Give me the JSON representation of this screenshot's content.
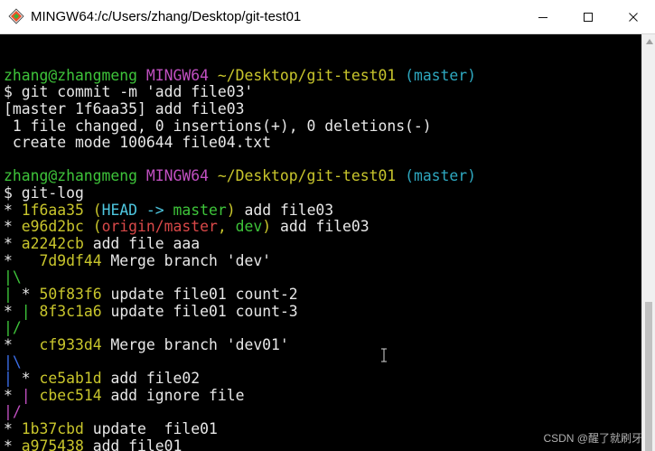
{
  "window": {
    "title": "MINGW64:/c/Users/zhang/Desktop/git-test01",
    "icon": "git-bash-icon",
    "controls": [
      "minimize-icon",
      "maximize-icon",
      "close-icon"
    ]
  },
  "colors": {
    "background": "#000000",
    "default_text": "#e8e8e8",
    "green": "#3ec43a",
    "magenta": "#c04fc0",
    "yellow": "#c9c62c",
    "cyan": "#2ea8c0",
    "bright_cyan": "#4ec7e0",
    "red": "#d84848",
    "graph_blue": "#3b6ee8"
  },
  "terminal": {
    "lines": [
      [],
      [
        {
          "text": "zhang@zhangmeng ",
          "color": "#3ec43a"
        },
        {
          "text": "MINGW64 ",
          "color": "#c04fc0"
        },
        {
          "text": "~/Desktop/git-test01 ",
          "color": "#c9c62c"
        },
        {
          "text": "(master)",
          "color": "#2ea8c0"
        }
      ],
      [
        {
          "text": "$ git commit -m 'add file03'",
          "color": "#e8e8e8"
        }
      ],
      [
        {
          "text": "[master 1f6aa35] add file03",
          "color": "#e8e8e8"
        }
      ],
      [
        {
          "text": " 1 file changed, 0 insertions(+), 0 deletions(-)",
          "color": "#e8e8e8"
        }
      ],
      [
        {
          "text": " create mode 100644 file04.txt",
          "color": "#e8e8e8"
        }
      ],
      [],
      [
        {
          "text": "zhang@zhangmeng ",
          "color": "#3ec43a"
        },
        {
          "text": "MINGW64 ",
          "color": "#c04fc0"
        },
        {
          "text": "~/Desktop/git-test01 ",
          "color": "#c9c62c"
        },
        {
          "text": "(master)",
          "color": "#2ea8c0"
        }
      ],
      [
        {
          "text": "$ git-log",
          "color": "#e8e8e8"
        }
      ],
      [
        {
          "text": "* ",
          "color": "#e8e8e8"
        },
        {
          "text": "1f6aa35",
          "color": "#c9c62c"
        },
        {
          "text": " (",
          "color": "#c9c62c"
        },
        {
          "text": "HEAD -> ",
          "color": "#4ec7e0"
        },
        {
          "text": "master",
          "color": "#3ec43a"
        },
        {
          "text": ")",
          "color": "#c9c62c"
        },
        {
          "text": " add file03",
          "color": "#e8e8e8"
        }
      ],
      [
        {
          "text": "* ",
          "color": "#e8e8e8"
        },
        {
          "text": "e96d2bc",
          "color": "#c9c62c"
        },
        {
          "text": " (",
          "color": "#c9c62c"
        },
        {
          "text": "origin/master",
          "color": "#d84848"
        },
        {
          "text": ", ",
          "color": "#c9c62c"
        },
        {
          "text": "dev",
          "color": "#3ec43a"
        },
        {
          "text": ")",
          "color": "#c9c62c"
        },
        {
          "text": " add file03",
          "color": "#e8e8e8"
        }
      ],
      [
        {
          "text": "* ",
          "color": "#e8e8e8"
        },
        {
          "text": "a2242cb",
          "color": "#c9c62c"
        },
        {
          "text": " add file aaa",
          "color": "#e8e8e8"
        }
      ],
      [
        {
          "text": "*   ",
          "color": "#e8e8e8"
        },
        {
          "text": "7d9df44",
          "color": "#c9c62c"
        },
        {
          "text": " Merge branch 'dev'",
          "color": "#e8e8e8"
        }
      ],
      [
        {
          "text": "|\\",
          "color": "#3ec43a"
        }
      ],
      [
        {
          "text": "| ",
          "color": "#3ec43a"
        },
        {
          "text": "* ",
          "color": "#e8e8e8"
        },
        {
          "text": "50f83f6",
          "color": "#c9c62c"
        },
        {
          "text": " update file01 count-2",
          "color": "#e8e8e8"
        }
      ],
      [
        {
          "text": "* ",
          "color": "#e8e8e8"
        },
        {
          "text": "| ",
          "color": "#3ec43a"
        },
        {
          "text": "8f3c1a6",
          "color": "#c9c62c"
        },
        {
          "text": " update file01 count-3",
          "color": "#e8e8e8"
        }
      ],
      [
        {
          "text": "|/",
          "color": "#3ec43a"
        }
      ],
      [
        {
          "text": "*   ",
          "color": "#e8e8e8"
        },
        {
          "text": "cf933d4",
          "color": "#c9c62c"
        },
        {
          "text": " Merge branch 'dev01'",
          "color": "#e8e8e8"
        }
      ],
      [
        {
          "text": "|\\",
          "color": "#3b6ee8"
        }
      ],
      [
        {
          "text": "| ",
          "color": "#3b6ee8"
        },
        {
          "text": "* ",
          "color": "#e8e8e8"
        },
        {
          "text": "ce5ab1d",
          "color": "#c9c62c"
        },
        {
          "text": " add file02",
          "color": "#e8e8e8"
        }
      ],
      [
        {
          "text": "* ",
          "color": "#e8e8e8"
        },
        {
          "text": "| ",
          "color": "#c04fc0"
        },
        {
          "text": "cbec514",
          "color": "#c9c62c"
        },
        {
          "text": " add ignore file",
          "color": "#e8e8e8"
        }
      ],
      [
        {
          "text": "|/",
          "color": "#c04fc0"
        }
      ],
      [
        {
          "text": "* ",
          "color": "#e8e8e8"
        },
        {
          "text": "1b37cbd",
          "color": "#c9c62c"
        },
        {
          "text": " update  file01",
          "color": "#e8e8e8"
        }
      ],
      [
        {
          "text": "* ",
          "color": "#e8e8e8"
        },
        {
          "text": "a975438",
          "color": "#c9c62c"
        },
        {
          "text": " add file01",
          "color": "#e8e8e8"
        }
      ]
    ]
  },
  "overlay": {
    "watermark": "CSDN @醒了就刷牙"
  }
}
